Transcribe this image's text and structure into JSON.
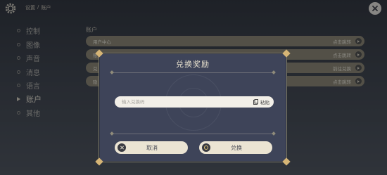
{
  "header": {
    "breadcrumb": [
      "设置",
      "/",
      "账户"
    ]
  },
  "icons": {
    "settings": "gear-icon",
    "close": "close-icon"
  },
  "sidebar": {
    "items": [
      {
        "label": "控制"
      },
      {
        "label": "图像"
      },
      {
        "label": "声音"
      },
      {
        "label": "消息"
      },
      {
        "label": "语言"
      },
      {
        "label": "账户"
      },
      {
        "label": "其他"
      }
    ],
    "active": "账户"
  },
  "account": {
    "section_title": "账户",
    "rows": [
      {
        "label": "用户中心",
        "action": "点击跳转"
      },
      {
        "label": "账户",
        "action": "点击跳转"
      },
      {
        "label": "兑",
        "action": "前往兑换"
      },
      {
        "label": "隐",
        "action": "点击跳转"
      }
    ]
  },
  "modal": {
    "title": "兑换奖励",
    "code_placeholder": "输入兑换码",
    "code_value": "",
    "paste_label": "粘贴",
    "cancel_label": "取消",
    "confirm_label": "兑换"
  },
  "colors": {
    "modal_bg": "#3e4459",
    "button_bg": "#ebe4d3",
    "accent_gold": "#d6b576"
  }
}
